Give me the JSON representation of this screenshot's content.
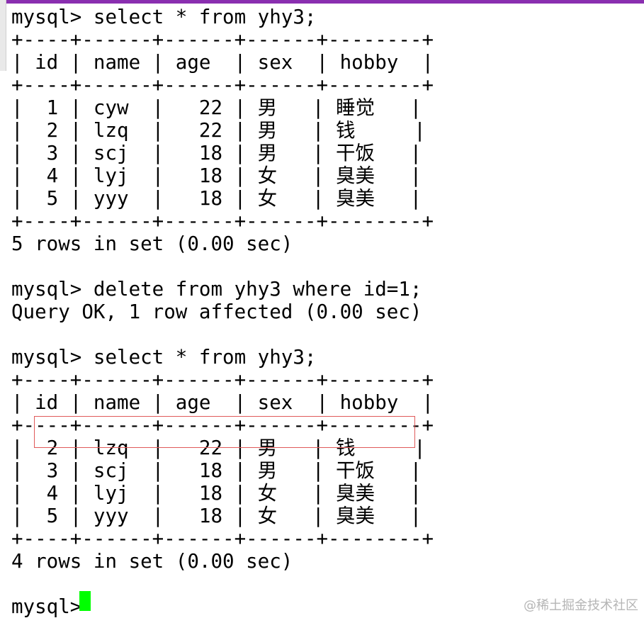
{
  "terminal": {
    "lines": [
      "mysql> select * from yhy3;",
      "+----+------+------+------+--------+",
      "| id | name | age  | sex  | hobby  |",
      "+----+------+------+------+--------+",
      "|  1 | cyw  |   22 | 男   | 睡觉   |",
      "|  2 | lzq  |   22 | 男   | 钱     |",
      "|  3 | scj  |   18 | 男   | 干饭   |",
      "|  4 | lyj  |   18 | 女   | 臭美   |",
      "|  5 | yyy  |   18 | 女   | 臭美   |",
      "+----+------+------+------+--------+",
      "5 rows in set (0.00 sec)",
      "",
      "mysql> delete from yhy3 where id=1;",
      "Query OK, 1 row affected (0.00 sec)",
      "",
      "mysql> select * from yhy3;",
      "+----+------+------+------+--------+",
      "| id | name | age  | sex  | hobby  |",
      "+----+------+------+------+--------+",
      "|  2 | lzq  |   22 | 男   | 钱     |",
      "|  3 | scj  |   18 | 男   | 干饭   |",
      "|  4 | lyj  |   18 | 女   | 臭美   |",
      "|  5 | yyy  |   18 | 女   | 臭美   |",
      "+----+------+------+------+--------+",
      "4 rows in set (0.00 sec)",
      "",
      "mysql> "
    ]
  },
  "watermark": "@稀土掘金技术社区",
  "colors": {
    "background": "#ffffff",
    "text": "#000000",
    "cursor": "#00ff00",
    "highlight_border": "#e05a5a",
    "top_accent": "#8a2fb0"
  }
}
